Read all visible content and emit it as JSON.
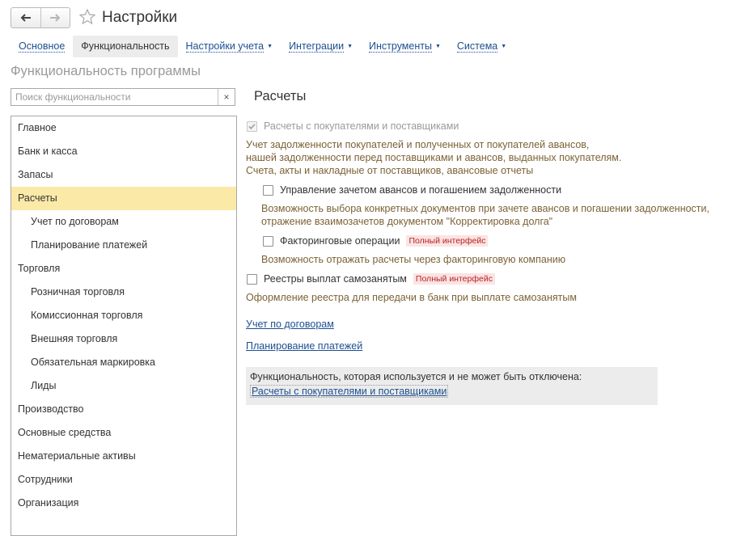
{
  "window": {
    "title": "Настройки"
  },
  "nav": {
    "back_icon": "arrow-left-icon",
    "forward_icon": "arrow-right-icon",
    "favorite_icon": "star-icon"
  },
  "tabs": [
    {
      "label": "Основное",
      "dropdown": false,
      "active": false
    },
    {
      "label": "Функциональность",
      "dropdown": false,
      "active": true
    },
    {
      "label": "Настройки учета",
      "dropdown": true,
      "active": false
    },
    {
      "label": "Интеграции",
      "dropdown": true,
      "active": false
    },
    {
      "label": "Инструменты",
      "dropdown": true,
      "active": false
    },
    {
      "label": "Система",
      "dropdown": true,
      "active": false
    }
  ],
  "section_title": "Функциональность программы",
  "search": {
    "placeholder": "Поиск функциональности",
    "value": "",
    "clear_icon": "close-icon"
  },
  "tree": [
    {
      "label": "Главное",
      "level": 0
    },
    {
      "label": "Банк и касса",
      "level": 0
    },
    {
      "label": "Запасы",
      "level": 0
    },
    {
      "label": "Расчеты",
      "level": 0,
      "selected": true
    },
    {
      "label": "Учет по договорам",
      "level": 1
    },
    {
      "label": "Планирование платежей",
      "level": 1
    },
    {
      "label": "Торговля",
      "level": 0
    },
    {
      "label": "Розничная торговля",
      "level": 1
    },
    {
      "label": "Комиссионная торговля",
      "level": 1
    },
    {
      "label": "Внешняя торговля",
      "level": 1
    },
    {
      "label": "Обязательная маркировка",
      "level": 1
    },
    {
      "label": "Лиды",
      "level": 1
    },
    {
      "label": "Производство",
      "level": 0
    },
    {
      "label": "Основные средства",
      "level": 0
    },
    {
      "label": "Нематериальные активы",
      "level": 0
    },
    {
      "label": "Сотрудники",
      "level": 0
    },
    {
      "label": "Организация",
      "level": 0
    }
  ],
  "panel": {
    "title": "Расчеты",
    "main_option": {
      "label": "Расчеты с покупателями и поставщиками",
      "checked": true,
      "disabled": true,
      "desc": [
        "Учет задолженности покупателей и полученных от покупателей авансов,",
        "нашей задолженности перед поставщиками и авансов, выданных покупателям.",
        "Счета, акты и накладные от поставщиков, авансовые отчеты"
      ]
    },
    "opt_offset": {
      "label": "Управление зачетом авансов и погашением задолженности",
      "checked": false,
      "desc": [
        "Возможность выбора конкретных документов при зачете авансов и погашении задолженности,",
        "отражение взаимозачетов документом \"Корректировка долга\""
      ]
    },
    "opt_factoring": {
      "label": "Факторинговые операции",
      "checked": false,
      "badge": "Полный интерфейс",
      "desc": "Возможность отражать расчеты через факторинговую компанию"
    },
    "opt_selfemployed": {
      "label": "Реестры выплат самозанятым",
      "checked": false,
      "badge": "Полный интерфейс",
      "desc": "Оформление реестра для передачи в банк при выплате самозанятым"
    },
    "links": [
      "Учет по договорам",
      "Планирование платежей"
    ],
    "notice": {
      "text": "Функциональность, которая используется и не может быть отключена:",
      "link": "Расчеты с покупателями и поставщиками"
    }
  }
}
